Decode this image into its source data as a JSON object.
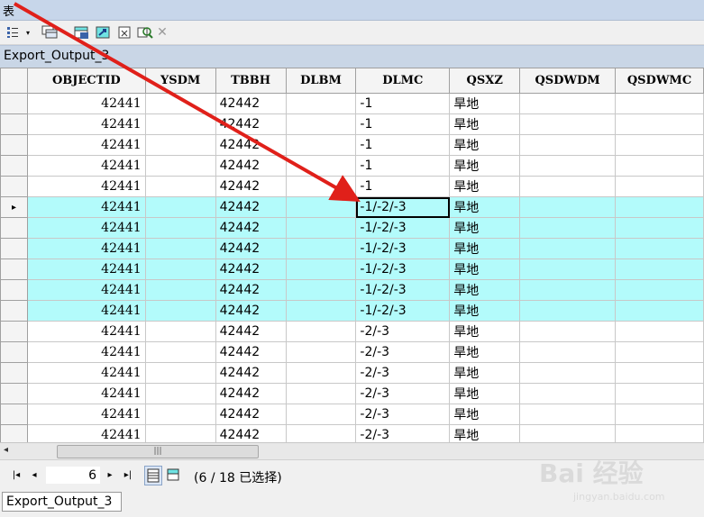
{
  "window": {
    "title": "表"
  },
  "toolbar": {
    "icons": [
      "table-options-icon",
      "dropdown-icon",
      "related-tables-icon",
      "select-by-attributes-icon",
      "switch-selection-icon",
      "clear-selection-icon",
      "zoom-to-selected-icon",
      "delete-selected-icon"
    ]
  },
  "table": {
    "name": "Export_Output_3",
    "columns": [
      "OBJECTID",
      "YSDM",
      "TBBH",
      "DLBM",
      "DLMC",
      "QSXZ",
      "QSDWDM",
      "QSDWMC"
    ],
    "rows": [
      {
        "objectid": "42441",
        "ysdm": "",
        "tbbh": "42442",
        "dlbm": "",
        "dlmc": "-1",
        "qsxz": "旱地",
        "selected": false
      },
      {
        "objectid": "42441",
        "ysdm": "",
        "tbbh": "42442",
        "dlbm": "",
        "dlmc": "-1",
        "qsxz": "旱地",
        "selected": false
      },
      {
        "objectid": "42441",
        "ysdm": "",
        "tbbh": "42442",
        "dlbm": "",
        "dlmc": "-1",
        "qsxz": "旱地",
        "selected": false
      },
      {
        "objectid": "42441",
        "ysdm": "",
        "tbbh": "42442",
        "dlbm": "",
        "dlmc": "-1",
        "qsxz": "旱地",
        "selected": false
      },
      {
        "objectid": "42441",
        "ysdm": "",
        "tbbh": "42442",
        "dlbm": "",
        "dlmc": "-1",
        "qsxz": "旱地",
        "selected": false
      },
      {
        "objectid": "42441",
        "ysdm": "",
        "tbbh": "42442",
        "dlbm": "",
        "dlmc": "-1/-2/-3",
        "qsxz": "旱地",
        "selected": true
      },
      {
        "objectid": "42441",
        "ysdm": "",
        "tbbh": "42442",
        "dlbm": "",
        "dlmc": "-1/-2/-3",
        "qsxz": "旱地",
        "selected": true
      },
      {
        "objectid": "42441",
        "ysdm": "",
        "tbbh": "42442",
        "dlbm": "",
        "dlmc": "-1/-2/-3",
        "qsxz": "旱地",
        "selected": true
      },
      {
        "objectid": "42441",
        "ysdm": "",
        "tbbh": "42442",
        "dlbm": "",
        "dlmc": "-1/-2/-3",
        "qsxz": "旱地",
        "selected": true
      },
      {
        "objectid": "42441",
        "ysdm": "",
        "tbbh": "42442",
        "dlbm": "",
        "dlmc": "-1/-2/-3",
        "qsxz": "旱地",
        "selected": true
      },
      {
        "objectid": "42441",
        "ysdm": "",
        "tbbh": "42442",
        "dlbm": "",
        "dlmc": "-1/-2/-3",
        "qsxz": "旱地",
        "selected": true
      },
      {
        "objectid": "42441",
        "ysdm": "",
        "tbbh": "42442",
        "dlbm": "",
        "dlmc": "-2/-3",
        "qsxz": "旱地",
        "selected": false
      },
      {
        "objectid": "42441",
        "ysdm": "",
        "tbbh": "42442",
        "dlbm": "",
        "dlmc": "-2/-3",
        "qsxz": "旱地",
        "selected": false
      },
      {
        "objectid": "42441",
        "ysdm": "",
        "tbbh": "42442",
        "dlbm": "",
        "dlmc": "-2/-3",
        "qsxz": "旱地",
        "selected": false
      },
      {
        "objectid": "42441",
        "ysdm": "",
        "tbbh": "42442",
        "dlbm": "",
        "dlmc": "-2/-3",
        "qsxz": "旱地",
        "selected": false
      },
      {
        "objectid": "42441",
        "ysdm": "",
        "tbbh": "42442",
        "dlbm": "",
        "dlmc": "-2/-3",
        "qsxz": "旱地",
        "selected": false
      },
      {
        "objectid": "42441",
        "ysdm": "",
        "tbbh": "42442",
        "dlbm": "",
        "dlmc": "-2/-3",
        "qsxz": "旱地",
        "selected": false
      }
    ],
    "current_row_index": 5,
    "highlight_color": "#b3fbfb"
  },
  "navigation": {
    "current_record": "6",
    "status": "(6 / 18 已选择)"
  },
  "bottom_tab": {
    "label": "Export_Output_3"
  },
  "watermark": {
    "text": "Bai 经验",
    "subtext": "jingyan.baidu.com"
  },
  "annotation": {
    "arrow_color": "#e0201a"
  }
}
